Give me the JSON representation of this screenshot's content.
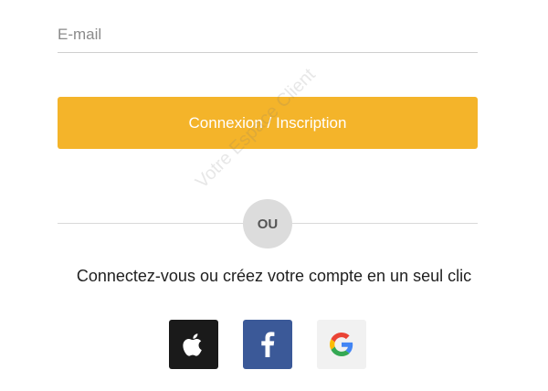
{
  "login": {
    "email_placeholder": "E-mail",
    "submit_label": "Connexion / Inscription",
    "or_label": "OU",
    "social_prompt": "Connectez-vous ou créez votre compte en un seul clic"
  },
  "social_buttons": [
    {
      "provider": "apple",
      "icon": "apple-icon",
      "color": "#1a1a1a"
    },
    {
      "provider": "facebook",
      "icon": "facebook-icon",
      "color": "#3b5998"
    },
    {
      "provider": "google",
      "icon": "google-icon",
      "color": "#f1f1f1"
    }
  ],
  "colors": {
    "accent": "#f4b42a",
    "facebook": "#3b5998",
    "apple": "#1a1a1a"
  },
  "watermark": "Votre Espace Client"
}
